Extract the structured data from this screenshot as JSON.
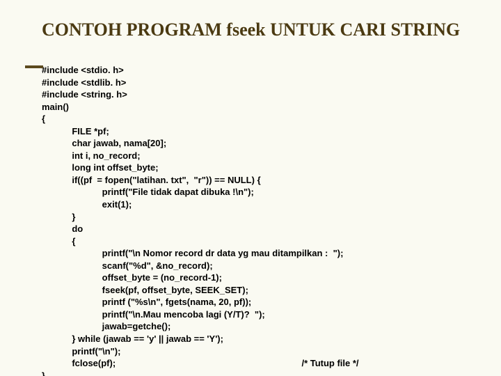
{
  "title": "CONTOH PROGRAM fseek UNTUK CARI STRING",
  "code": {
    "l1": "#include <stdio. h>",
    "l2": "#include <stdlib. h>",
    "l3": "#include <string. h>",
    "l4": "main()",
    "l5": "{",
    "l6": "            FILE *pf;",
    "l7": "            char jawab, nama[20];",
    "l8": "            int i, no_record;",
    "l9": "            long int offset_byte;",
    "l10": "            if((pf  = fopen(\"latihan. txt\",  \"r\")) == NULL) {",
    "l11": "                        printf(\"File tidak dapat dibuka !\\n\");",
    "l12": "                        exit(1);",
    "l13": "            }",
    "l14": "            do",
    "l15": "            {",
    "l16": "                        printf(\"\\n Nomor record dr data yg mau ditampilkan :  \");",
    "l17": "                        scanf(\"%d\", &no_record);",
    "l18": "                        offset_byte = (no_record-1);",
    "l19": "                        fseek(pf, offset_byte, SEEK_SET);",
    "l20": "                        printf (\"%s\\n\", fgets(nama, 20, pf));",
    "l21": "                        printf(\"\\n.Mau mencoba lagi (Y/T)?  \");",
    "l22": "                        jawab=getche();",
    "l23": "            } while (jawab == 'y' || jawab == 'Y');",
    "l24": "            printf(\"\\n\");",
    "l25a": "            fclose(pf);",
    "l25b": "/* Tutup file */",
    "l26": "}"
  }
}
